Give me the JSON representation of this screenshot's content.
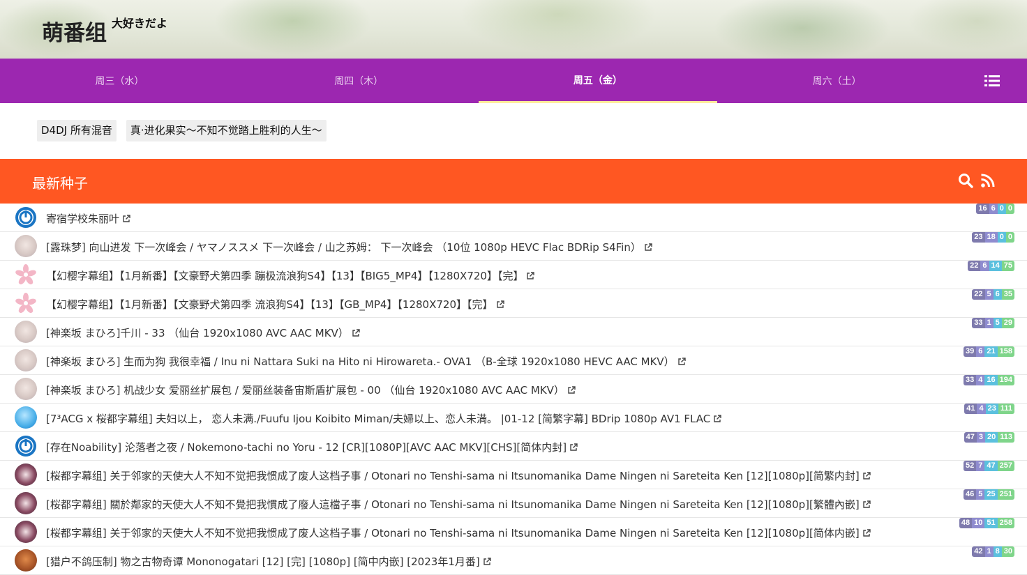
{
  "site": {
    "title": "萌番组",
    "subtitle": "大好きだよ"
  },
  "nav": {
    "tabs": [
      {
        "label": "周三（水）",
        "active": false
      },
      {
        "label": "周四（木）",
        "active": false
      },
      {
        "label": "周五（金）",
        "active": true
      },
      {
        "label": "周六（土）",
        "active": false
      }
    ],
    "menu_icon": "list-icon"
  },
  "chips": [
    "D4DJ 所有混音",
    "真·进化果实～不知不觉踏上胜利的人生～"
  ],
  "section": {
    "title": "最新种子",
    "icons": [
      "search-icon",
      "rss-icon"
    ]
  },
  "colors": {
    "nav": "#9c27b0",
    "section": "#ff5722",
    "active_underline": "#ffeb9c",
    "badge_1": "#7e7aad",
    "badge_2": "#8f8ccf",
    "badge_3": "#5bc0de",
    "badge_4": "#7fd58a"
  },
  "torrents": [
    {
      "avatar": "power",
      "title": "寄宿学校朱丽叶",
      "stats": [
        "16",
        "6",
        "0",
        "0"
      ]
    },
    {
      "avatar": "girl",
      "title": "[露珠梦] 向山进发 下一次峰会 / ヤマノススメ 下一次峰会 / 山之苏姆： 下一次峰会 （10位 1080p HEVC Flac BDRip S4Fin）",
      "stats": [
        "23",
        "18",
        "0",
        "0"
      ]
    },
    {
      "avatar": "flower",
      "title": "【幻樱字幕组】【1月新番】【文豪野犬第四季 蹦极流浪狗S4】【13】【BIG5_MP4】【1280X720】【完】",
      "stats": [
        "22",
        "6",
        "14",
        "75"
      ]
    },
    {
      "avatar": "flower",
      "title": "【幻樱字幕组】【1月新番】【文豪野犬第四季 流浪狗S4】【13】【GB_MP4】【1280X720】【完】",
      "stats": [
        "22",
        "5",
        "6",
        "35"
      ]
    },
    {
      "avatar": "girl",
      "title": "[神楽坂 まひろ]千川 - 33 （仙台 1920x1080 AVC AAC MKV）",
      "stats": [
        "33",
        "1",
        "5",
        "29"
      ]
    },
    {
      "avatar": "girl",
      "title": "[神楽坂 まひろ] 生而为狗 我很幸福 / Inu ni Nattara Suki na Hito ni Hirowareta.- OVA1 （B-全球 1920x1080 HEVC AAC MKV）",
      "stats": [
        "39",
        "6",
        "21",
        "158"
      ]
    },
    {
      "avatar": "girl",
      "title": "[神楽坂 まひろ] 机战少女 爱丽丝扩展包 / 爱丽丝装备宙斯盾扩展包 - 00 （仙台 1920x1080 AVC AAC MKV）",
      "stats": [
        "33",
        "4",
        "16",
        "194"
      ]
    },
    {
      "avatar": "blue",
      "title": "[7³ACG x 桜都字幕组] 夫妇以上， 恋人未满./Fuufu Ijou Koibito Miman/夫婦以上、恋人未満。 |01-12 [简繁字幕] BDrip 1080p AV1 FLAC",
      "stats": [
        "41",
        "4",
        "23",
        "111"
      ]
    },
    {
      "avatar": "power",
      "title": "[存在Noability] 沦落者之夜 / Nokemono-tachi no Yoru - 12 [CR][1080P][AVC AAC MKV][CHS][简体内封]",
      "stats": [
        "47",
        "3",
        "20",
        "113"
      ]
    },
    {
      "avatar": "dark",
      "title": "[桜都字幕组] 关于邻家的天使大人不知不觉把我惯成了废人这档子事 / Otonari no Tenshi-sama ni Itsunomanika Dame Ningen ni Sareteita Ken [12][1080p][简繁内封]",
      "stats": [
        "52",
        "7",
        "47",
        "257"
      ]
    },
    {
      "avatar": "dark",
      "title": "[桜都字幕组] 關於鄰家的天使大人不知不覺把我慣成了廢人這檔子事 / Otonari no Tenshi-sama ni Itsunomanika Dame Ningen ni Sareteita Ken [12][1080p][繁體內嵌]",
      "stats": [
        "46",
        "5",
        "25",
        "251"
      ]
    },
    {
      "avatar": "dark",
      "title": "[桜都字幕组] 关于邻家的天使大人不知不觉把我惯成了废人这档子事 / Otonari no Tenshi-sama ni Itsunomanika Dame Ningen ni Sareteita Ken [12][1080p][简体内嵌]",
      "stats": [
        "48",
        "10",
        "51",
        "258"
      ]
    },
    {
      "avatar": "brown",
      "title": "[猎户不鸽压制] 物之古物奇谭 Mononogatari [12] [完] [1080p] [简中内嵌] [2023年1月番]",
      "stats": [
        "42",
        "1",
        "8",
        "30"
      ]
    }
  ]
}
